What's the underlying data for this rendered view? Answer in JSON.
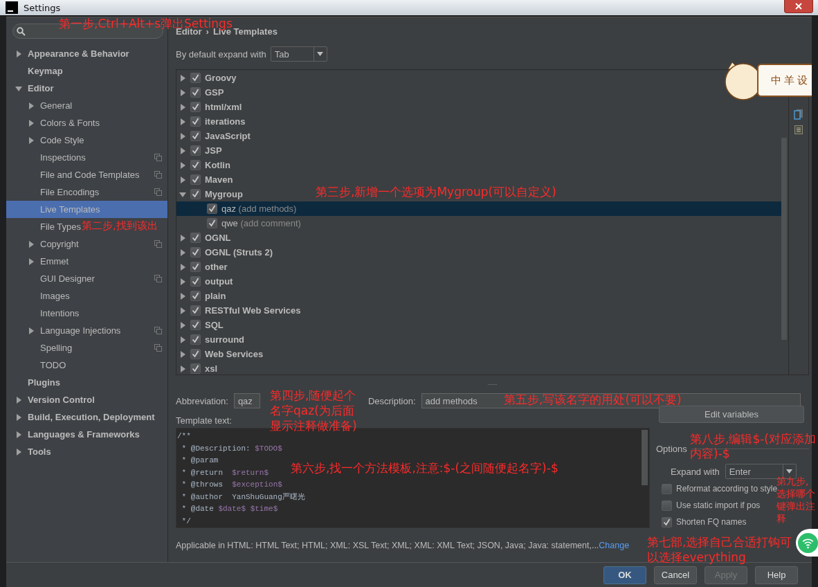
{
  "window": {
    "title": "Settings"
  },
  "sidebar": {
    "items": [
      {
        "label": "Appearance & Behavior",
        "kind": "node",
        "expanded": false,
        "selected": false
      },
      {
        "label": "Keymap",
        "kind": "leaf",
        "selected": false
      },
      {
        "label": "Editor",
        "kind": "node",
        "expanded": true,
        "selected": false,
        "children": [
          {
            "label": "General",
            "kind": "node",
            "expanded": false,
            "selected": false
          },
          {
            "label": "Colors & Fonts",
            "kind": "node",
            "expanded": false,
            "selected": false
          },
          {
            "label": "Code Style",
            "kind": "node",
            "expanded": false,
            "selected": false
          },
          {
            "label": "Inspections",
            "kind": "leaf",
            "project": true,
            "selected": false
          },
          {
            "label": "File and Code Templates",
            "kind": "leaf",
            "project": true,
            "selected": false
          },
          {
            "label": "File Encodings",
            "kind": "leaf",
            "project": true,
            "selected": false
          },
          {
            "label": "Live Templates",
            "kind": "leaf",
            "project": false,
            "selected": true
          },
          {
            "label": "File Types",
            "kind": "leaf",
            "project": false,
            "selected": false
          },
          {
            "label": "Copyright",
            "kind": "node",
            "expanded": false,
            "project": true,
            "selected": false
          },
          {
            "label": "Emmet",
            "kind": "node",
            "expanded": false,
            "selected": false
          },
          {
            "label": "GUI Designer",
            "kind": "leaf",
            "project": true,
            "selected": false
          },
          {
            "label": "Images",
            "kind": "leaf",
            "selected": false
          },
          {
            "label": "Intentions",
            "kind": "leaf",
            "selected": false
          },
          {
            "label": "Language Injections",
            "kind": "node",
            "expanded": false,
            "project": true,
            "selected": false
          },
          {
            "label": "Spelling",
            "kind": "leaf",
            "project": true,
            "selected": false
          },
          {
            "label": "TODO",
            "kind": "leaf",
            "selected": false
          }
        ]
      },
      {
        "label": "Plugins",
        "kind": "leaf",
        "selected": false
      },
      {
        "label": "Version Control",
        "kind": "node",
        "expanded": false,
        "selected": false
      },
      {
        "label": "Build, Execution, Deployment",
        "kind": "node",
        "expanded": false,
        "selected": false
      },
      {
        "label": "Languages & Frameworks",
        "kind": "node",
        "expanded": false,
        "selected": false
      },
      {
        "label": "Tools",
        "kind": "node",
        "expanded": false,
        "selected": false
      }
    ]
  },
  "breadcrumb": [
    "Editor",
    "›",
    "Live Templates"
  ],
  "expand_default": {
    "label": "By default expand with",
    "value": "Tab"
  },
  "template_groups": [
    {
      "name": "Groovy",
      "checked": true,
      "expanded": false
    },
    {
      "name": "GSP",
      "checked": true,
      "expanded": false
    },
    {
      "name": "html/xml",
      "checked": true,
      "expanded": false
    },
    {
      "name": "iterations",
      "checked": true,
      "expanded": false
    },
    {
      "name": "JavaScript",
      "checked": true,
      "expanded": false
    },
    {
      "name": "JSP",
      "checked": true,
      "expanded": false
    },
    {
      "name": "Kotlin",
      "checked": true,
      "expanded": false
    },
    {
      "name": "Maven",
      "checked": true,
      "expanded": false
    },
    {
      "name": "Mygroup",
      "checked": true,
      "expanded": true,
      "children": [
        {
          "abbreviation": "qaz",
          "description": "(add methods)",
          "checked": true,
          "selected": true
        },
        {
          "abbreviation": "qwe",
          "description": "(add comment)",
          "checked": true,
          "selected": false
        }
      ]
    },
    {
      "name": "OGNL",
      "checked": true,
      "expanded": false
    },
    {
      "name": "OGNL (Struts 2)",
      "checked": true,
      "expanded": false
    },
    {
      "name": "other",
      "checked": true,
      "expanded": false
    },
    {
      "name": "output",
      "checked": true,
      "expanded": false
    },
    {
      "name": "plain",
      "checked": true,
      "expanded": false
    },
    {
      "name": "RESTful Web Services",
      "checked": true,
      "expanded": false
    },
    {
      "name": "SQL",
      "checked": true,
      "expanded": false
    },
    {
      "name": "surround",
      "checked": true,
      "expanded": false
    },
    {
      "name": "Web Services",
      "checked": true,
      "expanded": false
    },
    {
      "name": "xsl",
      "checked": true,
      "expanded": false
    }
  ],
  "abbreviation": {
    "label": "Abbreviation:",
    "value": "qaz"
  },
  "description": {
    "label": "Description:",
    "value": "add methods"
  },
  "template_text": {
    "label": "Template text:",
    "lines": [
      [
        {
          "kind": "plain",
          "text": "/**"
        }
      ],
      [
        {
          "kind": "plain",
          "text": " * @Description: "
        },
        {
          "kind": "var",
          "text": "$TODO$"
        }
      ],
      [
        {
          "kind": "plain",
          "text": " * @param"
        }
      ],
      [
        {
          "kind": "plain",
          "text": " * @return  "
        },
        {
          "kind": "var",
          "text": "$return$"
        }
      ],
      [
        {
          "kind": "plain",
          "text": " * @throws  "
        },
        {
          "kind": "var",
          "text": "$exception$"
        }
      ],
      [
        {
          "kind": "plain",
          "text": " * @author  YanShuGuang严曙光"
        }
      ],
      [
        {
          "kind": "plain",
          "text": " * @date "
        },
        {
          "kind": "var",
          "text": "$date$ $time$"
        }
      ],
      [
        {
          "kind": "plain",
          "text": " */"
        }
      ]
    ]
  },
  "edit_variables": "Edit variables",
  "options": {
    "label": "Options",
    "expand_with": {
      "label": "Expand with",
      "value": "Enter"
    },
    "checkboxes": [
      {
        "label": "Reformat according to style",
        "checked": false
      },
      {
        "label": "Use static import if pos",
        "checked": false
      },
      {
        "label": "Shorten FQ names",
        "checked": true
      }
    ]
  },
  "applicable": {
    "text": "Applicable in HTML: HTML Text; HTML; XML: XSL Text; XML; XML: XML Text; JSON, Java; Java: statement,...",
    "link": "Change"
  },
  "buttons": [
    {
      "label": "OK",
      "kind": "default"
    },
    {
      "label": "Cancel",
      "kind": "normal"
    },
    {
      "label": "Apply",
      "kind": "disabled"
    },
    {
      "label": "Help",
      "kind": "normal"
    }
  ],
  "sticker": {
    "text": "中 羊 设"
  },
  "annotations": [
    "第一步,Ctrl+Alt+s弹出Settings",
    "第三步,新增一个选项为Mygroup(可以自定义)",
    "第二步,找到该出",
    "第四步,随便起个名字qaz(为后面显示注释做准备)",
    "第五步,写该名字的用处(可以不要)",
    "第八步,编辑$-(对应添加内容)-$",
    "第六步,找一个方法模板,注意:$-(之间随便起名字)-$",
    "第九步,选择哪个键弹出注释",
    "第七部,选择自己合适打钩可以选择everything"
  ]
}
